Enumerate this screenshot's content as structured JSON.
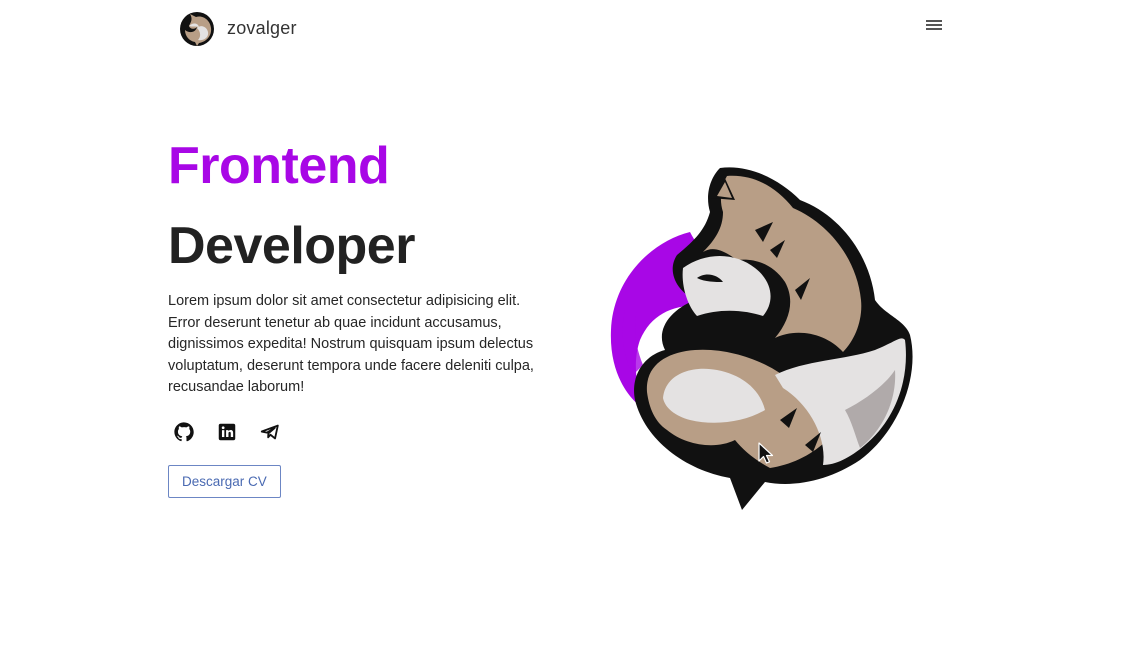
{
  "navbar": {
    "brand_name": "zovalger",
    "menu_icon": "hamburger-menu-icon"
  },
  "hero": {
    "title_line1": "Frontend",
    "title_line2": "Developer",
    "description": "Lorem ipsum dolor sit amet consectetur adipisicing elit. Error deserunt tenetur ab quae incidunt accusamus, dignissimos expedita! Nostrum quisquam ipsum delectus voluptatum, deserunt tempora unde facere deleniti culpa, recusandae laborum!",
    "socials": [
      {
        "icon": "github-icon"
      },
      {
        "icon": "linkedin-icon"
      },
      {
        "icon": "telegram-icon"
      }
    ],
    "cv_button_label": "Descargar CV",
    "image_icon": "fox-logo-illustration"
  },
  "colors": {
    "accent": "#a807e6",
    "heading": "#222222",
    "button_border": "#6c86c4",
    "button_text": "#4a6ab2",
    "fox_fur": "#b89e86",
    "fox_light": "#e4e2e2",
    "fox_outline": "#111111"
  }
}
